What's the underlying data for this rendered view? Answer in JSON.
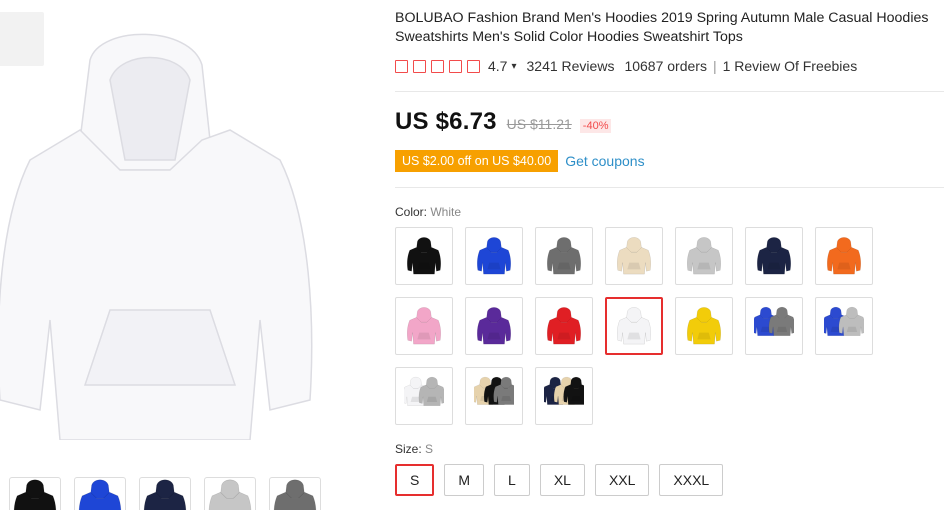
{
  "product": {
    "title": "BOLUBAO Fashion Brand Men's Hoodies 2019 Spring Autumn Male Casual Hoodies Sweatshirts Men's Solid Color Hoodies Sweatshirt Tops",
    "rating": "4.7",
    "rating_caret": "▾",
    "reviews": "3241 Reviews",
    "orders": "10687 orders",
    "freebies": "1 Review Of Freebies",
    "stars_count": 5
  },
  "pricing": {
    "price": "US $6.73",
    "old_price": "US $11.21",
    "discount": "-40%",
    "coupon": "US $2.00 off on US $40.00",
    "coupon_link": "Get coupons"
  },
  "color": {
    "label": "Color:",
    "selected": "White",
    "options": [
      {
        "name": "Black",
        "hex": "#111111"
      },
      {
        "name": "Royal Blue",
        "hex": "#1e46d6"
      },
      {
        "name": "Dark Gray",
        "hex": "#6e6e6e"
      },
      {
        "name": "Khaki",
        "hex": "#ecdcc0"
      },
      {
        "name": "Light Gray",
        "hex": "#c6c6c6"
      },
      {
        "name": "Navy",
        "hex": "#1c2444"
      },
      {
        "name": "Orange",
        "hex": "#f26a1e"
      },
      {
        "name": "Pink",
        "hex": "#f2a6c8"
      },
      {
        "name": "Purple",
        "hex": "#5a2a9a"
      },
      {
        "name": "Red",
        "hex": "#e01f24"
      },
      {
        "name": "White",
        "hex": "#f4f4f6"
      },
      {
        "name": "Yellow",
        "hex": "#f2cc0a"
      },
      {
        "name": "Blue Gray Pair",
        "hex": "#2c4ad0",
        "hex2": "#7a7a7a"
      },
      {
        "name": "Blue Light Gray Pair",
        "hex": "#2c4ad0",
        "hex2": "#bdbdbd"
      },
      {
        "name": "White Gray Pair",
        "hex": "#f4f4f6",
        "hex2": "#b5b5b5"
      },
      {
        "name": "Khaki Black Pair",
        "hex": "#e6d2ac",
        "hex2": "#121212",
        "hex3": "#7a7a7a"
      },
      {
        "name": "Navy Khaki Pair",
        "hex": "#1c2444",
        "hex2": "#e6d2ac",
        "hex3": "#121212"
      }
    ],
    "selected_index": 10
  },
  "size": {
    "label": "Size:",
    "selected": "S",
    "options": [
      "S",
      "M",
      "L",
      "XL",
      "XXL",
      "XXXL"
    ],
    "selected_index": 0
  },
  "gallery": {
    "main_color": "#f7f7f9",
    "thumbs": [
      "#ffffff",
      "#111111",
      "#1e46d6",
      "#1c2444",
      "#c6c6c6",
      "#6e6e6e"
    ]
  },
  "colors": {
    "accent_red": "#e62e2e",
    "coupon_orange": "#f7a000",
    "link_blue": "#2e8fc8"
  }
}
